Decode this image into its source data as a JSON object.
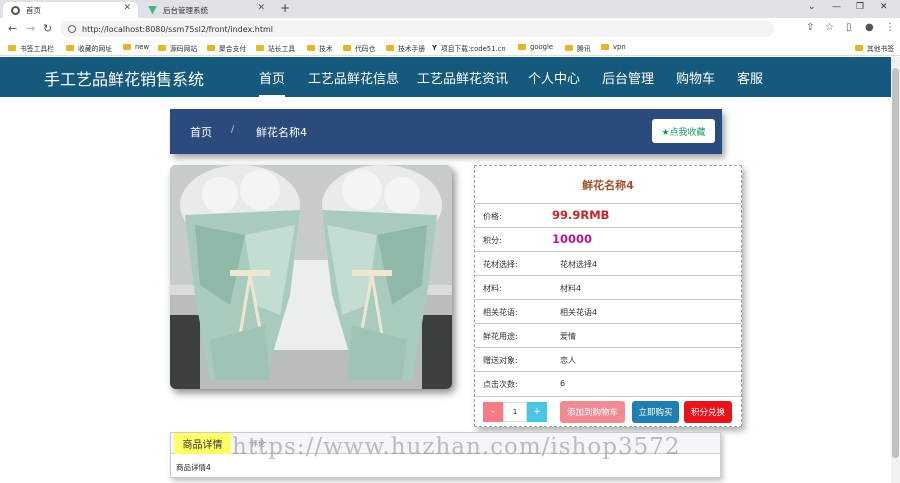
{
  "browser": {
    "tabs": [
      {
        "title": "首页",
        "active": true
      },
      {
        "title": "后台管理系统",
        "active": false
      }
    ],
    "url": "http://localhost:8080/ssm75sl2/front/index.html",
    "bookmarks": [
      "书签工具栏",
      "收藏的网址",
      "new",
      "源码网站",
      "聚合支付",
      "站长工具",
      "技术",
      "代码仓",
      "技术手册",
      "项目下载:code51.cn",
      "google",
      "腾讯",
      "vpn"
    ],
    "other_bookmarks": "其他书签"
  },
  "site": {
    "logo": "手工艺品鲜花销售系统",
    "nav": [
      "首页",
      "工艺品鲜花信息",
      "工艺品鲜花资讯",
      "个人中心",
      "后台管理",
      "购物车",
      "客服"
    ]
  },
  "breadcrumb": {
    "home": "首页",
    "separator": "/",
    "current": "鲜花名称4",
    "favorite": "★点我收藏"
  },
  "product": {
    "name": "鲜花名称4",
    "rows": [
      {
        "label": "价格:",
        "value": "99.9RMB",
        "kind": "price"
      },
      {
        "label": "积分:",
        "value": "10000",
        "kind": "points"
      },
      {
        "label": "花材选择:",
        "value": "花材选择4",
        "kind": "text"
      },
      {
        "label": "材料:",
        "value": "材料4",
        "kind": "text"
      },
      {
        "label": "相关花语:",
        "value": "相关花语4",
        "kind": "text"
      },
      {
        "label": "鲜花用途:",
        "value": "爱情",
        "kind": "text"
      },
      {
        "label": "赠送对象:",
        "value": "恋人",
        "kind": "text"
      },
      {
        "label": "点击次数:",
        "value": "6",
        "kind": "text"
      }
    ],
    "qty_minus": "-",
    "qty_value": "1",
    "qty_plus": "+",
    "add_cart": "添加到购物车",
    "buy_now": "立即购买",
    "redeem": "积分兑换"
  },
  "detail": {
    "tab_label": "商品详情",
    "second_tab": "评论",
    "content": "商品详情4"
  },
  "watermark": "https://www.huzhan.com/ishop3572",
  "colors": {
    "header": "#155a7d",
    "breadcrumb": "#2a4b7c",
    "price": "#c0272d",
    "points": "#c0178d",
    "add_cart": "#f08a93",
    "buy_now": "#1f7fb3",
    "redeem": "#e8141b"
  }
}
